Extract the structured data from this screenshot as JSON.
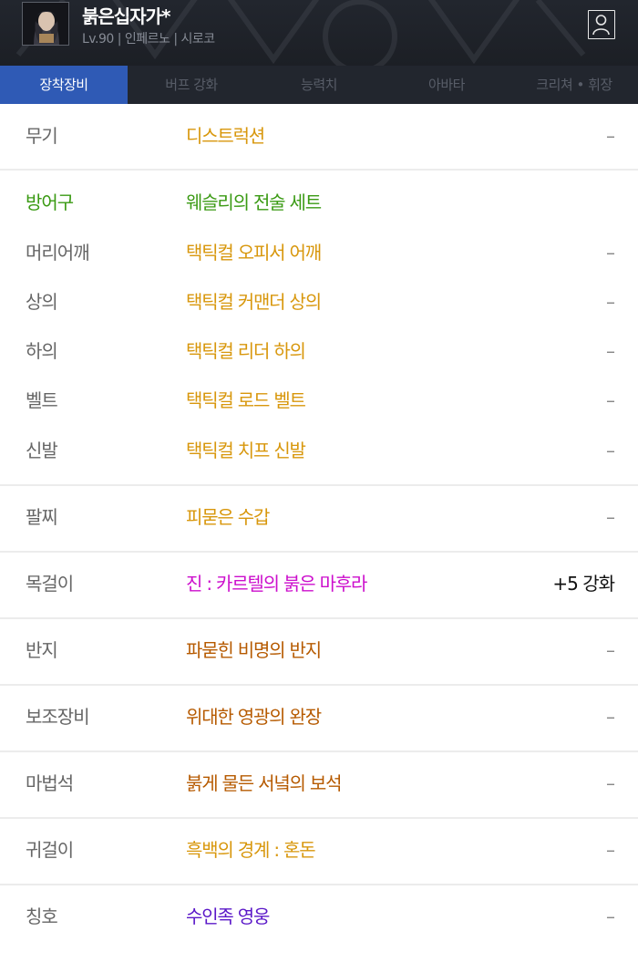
{
  "header": {
    "name": "붉은십자가*",
    "subtitle": "Lv.90 | 인페르노 | 시로코"
  },
  "tabs": [
    {
      "label": "장착장비",
      "active": true
    },
    {
      "label": "버프 강화",
      "active": false
    },
    {
      "label": "능력치",
      "active": false
    },
    {
      "label": "아바타",
      "active": false
    },
    {
      "label": "크리쳐 • 휘장",
      "active": false
    }
  ],
  "rows": [
    {
      "label": "무기",
      "item": "디스트럭션",
      "value": "–",
      "item_color": "#d8970c"
    },
    {
      "label": "방어구",
      "item": "웨슬리의 전술 세트",
      "value": "",
      "item_color": "#3a9a13",
      "label_color": "#3a9a13"
    },
    {
      "label": "머리어깨",
      "item": "택틱컬 오피서 어깨",
      "value": "–",
      "item_color": "#d8970c"
    },
    {
      "label": "상의",
      "item": "택틱컬 커맨더 상의",
      "value": "–",
      "item_color": "#d8970c"
    },
    {
      "label": "하의",
      "item": "택틱컬 리더 하의",
      "value": "–",
      "item_color": "#d8970c"
    },
    {
      "label": "벨트",
      "item": "택틱컬 로드 벨트",
      "value": "–",
      "item_color": "#d8970c"
    },
    {
      "label": "신발",
      "item": "택틱컬 치프 신발",
      "value": "–",
      "item_color": "#d8970c"
    },
    {
      "label": "팔찌",
      "item": "피묻은 수갑",
      "value": "–",
      "item_color": "#d8970c"
    },
    {
      "label": "목걸이",
      "item": "진 : 카르텔의 붉은 마후라",
      "value": "+5 강화",
      "item_color": "#cc0ecc"
    },
    {
      "label": "반지",
      "item": "파묻힌 비명의 반지",
      "value": "–",
      "item_color": "#b65a00"
    },
    {
      "label": "보조장비",
      "item": "위대한 영광의 완장",
      "value": "–",
      "item_color": "#b65a00"
    },
    {
      "label": "마법석",
      "item": "붉게 물든 서녘의 보석",
      "value": "–",
      "item_color": "#b65a00"
    },
    {
      "label": "귀걸이",
      "item": "흑백의 경계 : 혼돈",
      "value": "–",
      "item_color": "#d8970c"
    },
    {
      "label": "칭호",
      "item": "수인족 영웅",
      "value": "–",
      "item_color": "#5a17c8"
    }
  ],
  "colors": {
    "header_bg": "#1c1f25",
    "tab_active": "#2f5ab5",
    "epic": "#d8970c",
    "set": "#3a9a13",
    "legendary": "#b65a00",
    "unique": "#cc0ecc",
    "rare": "#5a17c8"
  }
}
